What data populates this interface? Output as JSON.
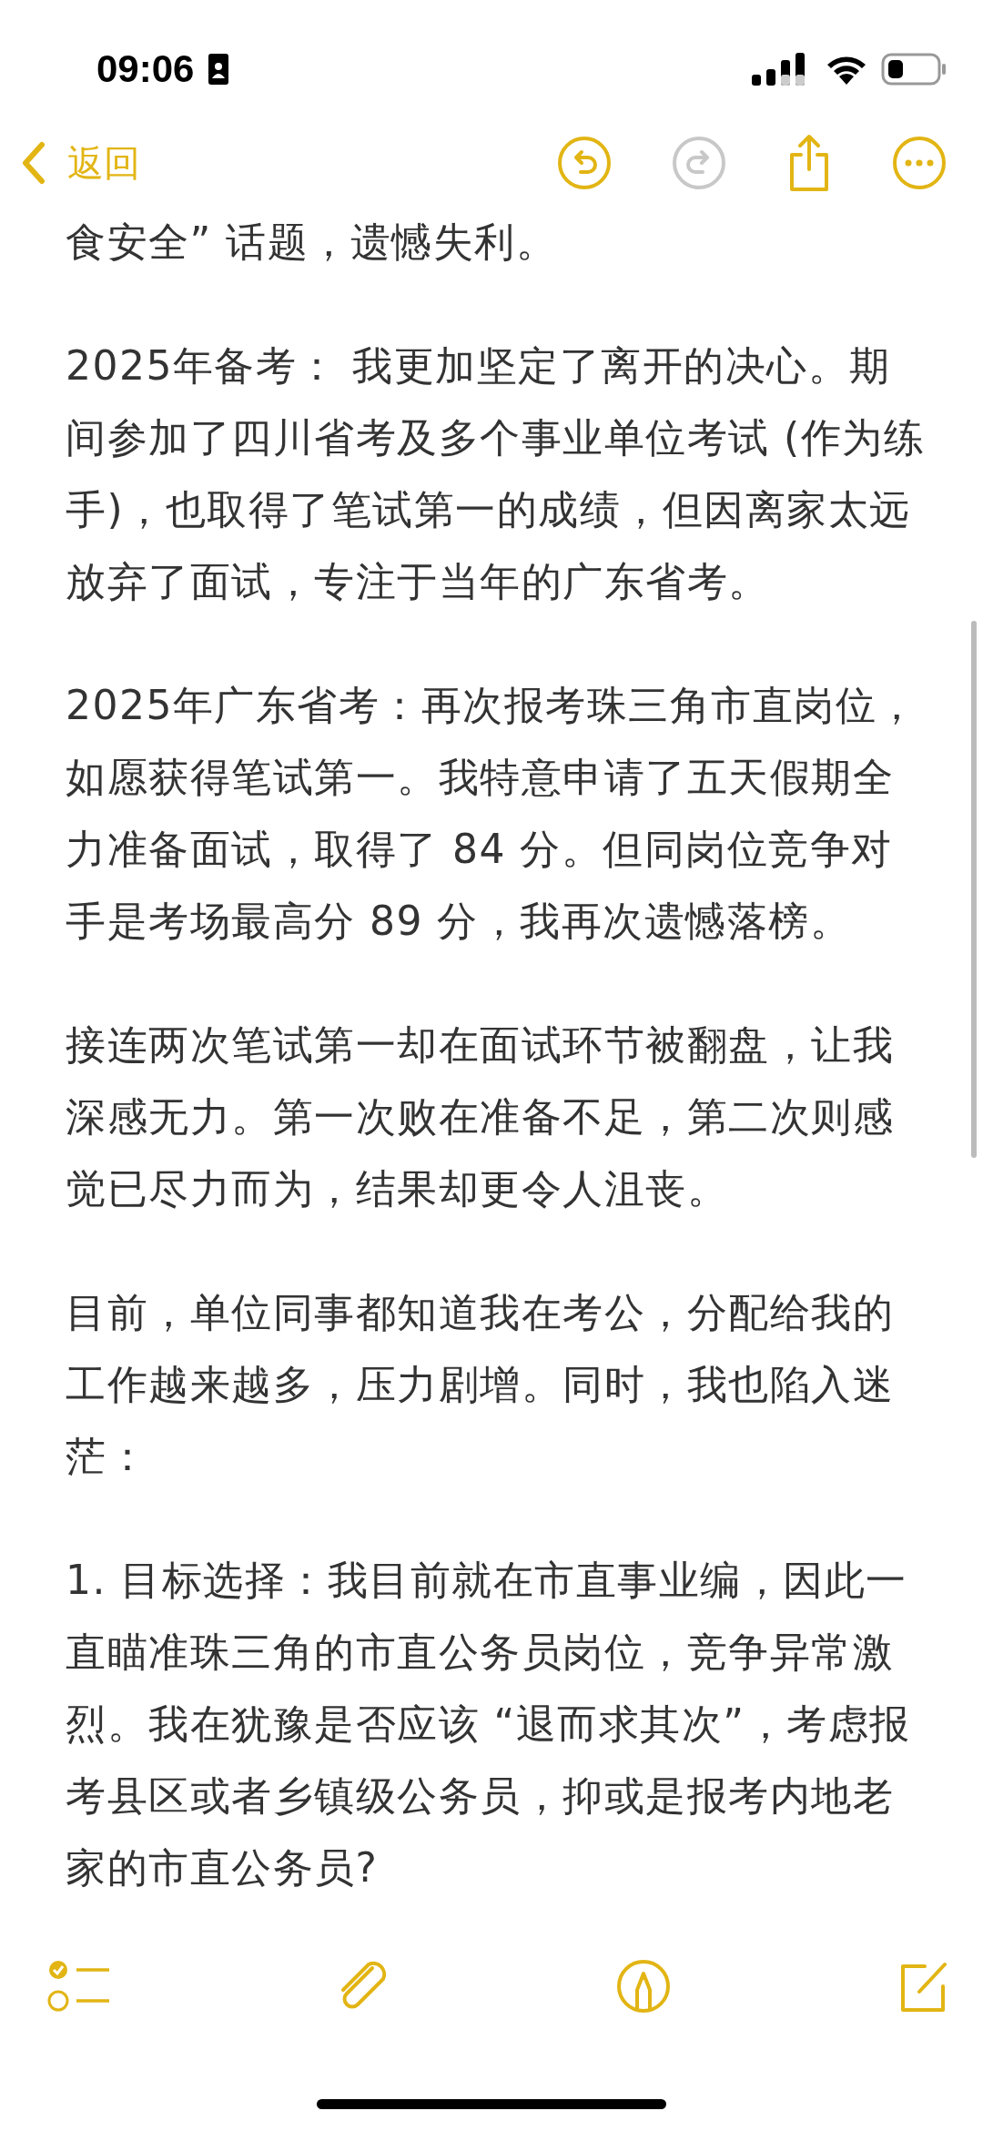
{
  "status_bar": {
    "time": "09:06"
  },
  "nav": {
    "back": "返回",
    "undo_enabled": true,
    "redo_enabled": false
  },
  "note": {
    "paragraphs": [
      "食安全” 话题，遗憾失利。",
      "2025年备考： 我更加坚定了离开的决心。期间参加了四川省考及多个事业单位考试 (作为练手)，也取得了笔试第一的成绩，但因离家太远放弃了面试，专注于当年的广东省考。",
      "2025年广东省考：再次报考珠三角市直岗位，如愿获得笔试第一。我特意申请了五天假期全力准备面试，取得了 84 分。但同岗位竞争对手是考场最高分 89 分，我再次遗憾落榜。",
      "接连两次笔试第一却在面试环节被翻盘，让我深感无力。第一次败在准备不足，第二次则感觉已尽力而为，结果却更令人沮丧。",
      "目前，单位同事都知道我在考公，分配给我的工作越来越多，压力剧增。同时，我也陷入迷茫：",
      "1. 目标选择：我目前就在市直事业编，因此一直瞄准珠三角的市直公务员岗位，竞争异常激烈。我在犹豫是否应该 “退而求其次”，考虑报考县区或者乡镇级公务员，抑或是报考内地老家的市直公务员?"
    ]
  }
}
